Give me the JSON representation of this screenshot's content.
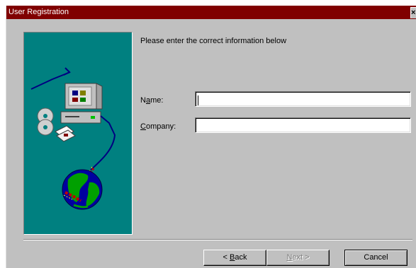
{
  "window": {
    "title": "User Registration",
    "close_glyph": "×"
  },
  "art": {
    "icon": "computer-network-globe-illustration"
  },
  "form": {
    "intro": "Please enter the correct information below",
    "name_label_pre": "N",
    "name_label_mnemonic": "a",
    "name_label_post": "me:",
    "name_value": "",
    "company_label_pre": "",
    "company_label_mnemonic": "C",
    "company_label_post": "ompany:",
    "company_value": ""
  },
  "buttons": {
    "back_prefix": "< ",
    "back_mnemonic": "B",
    "back_rest": "ack",
    "next_mnemonic": "N",
    "next_rest": "ext >",
    "cancel": "Cancel"
  },
  "colors": {
    "titlebar": "#800000",
    "dialog": "#c0c0c0",
    "art_background": "#008080"
  }
}
